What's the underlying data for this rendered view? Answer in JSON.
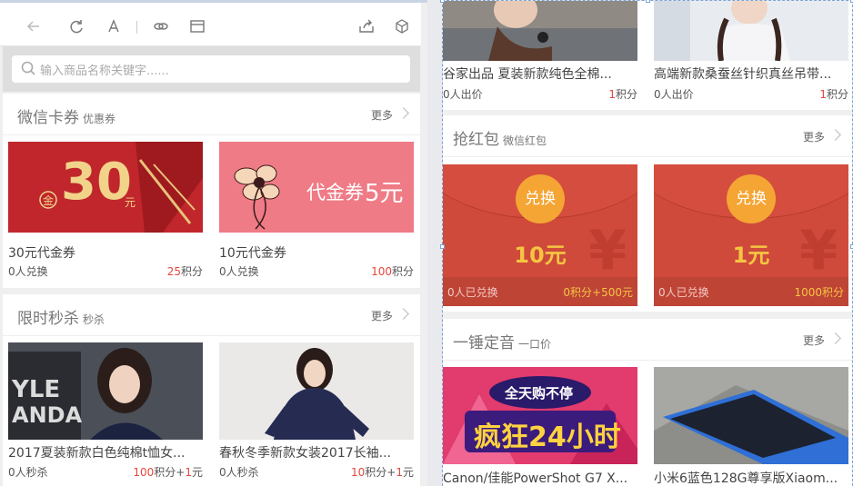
{
  "toolbar": {
    "icons": [
      "back-arrow-icon",
      "refresh-icon",
      "font-icon",
      "link-icon",
      "window-icon",
      "share-icon",
      "cube-icon"
    ]
  },
  "search": {
    "placeholder": "输入商品名称关键字......"
  },
  "left": {
    "sections": [
      {
        "title": "微信卡券",
        "subtitle": "优惠券",
        "more": "更多",
        "items": [
          {
            "title": "30元代金券",
            "left": "0人兑换",
            "points": "25",
            "points_unit": "积分",
            "extra": ""
          },
          {
            "title": "10元代金券",
            "left": "0人兑换",
            "points": "100",
            "points_unit": "积分",
            "extra": ""
          }
        ]
      },
      {
        "title": "限时秒杀",
        "subtitle": "秒杀",
        "more": "更多",
        "items": [
          {
            "title": "2017夏装新款白色纯棉t恤女...",
            "left": "0人秒杀",
            "points": "100",
            "points_unit": "积分+",
            "cash": "1",
            "cash_unit": "元"
          },
          {
            "title": "春秋冬季新款女装2017长袖...",
            "left": "0人秒杀",
            "points": "10",
            "points_unit": "积分+",
            "cash": "1",
            "cash_unit": "元"
          }
        ]
      }
    ],
    "coupon30": {
      "big": "30",
      "unit": "元",
      "stamp": "金"
    },
    "coupon10": {
      "text": "代金券",
      "amount": "5元"
    }
  },
  "right": {
    "top_items": [
      {
        "title": "谷家出品 夏装新款纯色全棉...",
        "left": "0人出价",
        "points": "1",
        "points_unit": "积分"
      },
      {
        "title": "高端新款桑蚕丝针织真丝吊带...",
        "left": "0人出价",
        "points": "1",
        "points_unit": "积分"
      }
    ],
    "redpack": {
      "title": "抢红包",
      "subtitle": "微信红包",
      "more": "更多",
      "items": [
        {
          "btn": "兑换",
          "amount": "10元",
          "left": "0人已兑换",
          "right": "0积分+500元"
        },
        {
          "btn": "兑换",
          "amount": "1元",
          "left": "0人已兑换",
          "right": "1000积分"
        }
      ]
    },
    "auction": {
      "title": "一锤定音",
      "subtitle": "一口价",
      "more": "更多",
      "items": [
        {
          "title": "Canon/佳能PowerShot G7 X..."
        },
        {
          "title": "小米6蓝色128G尊享版Xiaom..."
        }
      ],
      "banner": {
        "line1": "全天购不停",
        "line2": "疯狂24小时"
      }
    }
  }
}
